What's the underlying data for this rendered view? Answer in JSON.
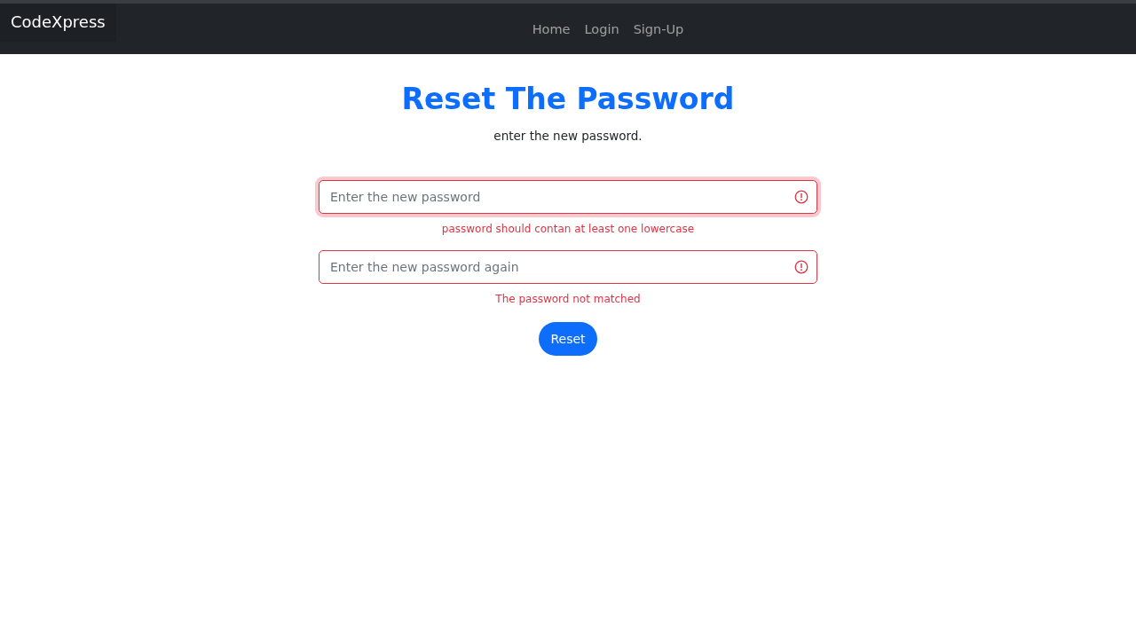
{
  "navbar": {
    "brand": "CodeXpress",
    "links": [
      {
        "label": "Home"
      },
      {
        "label": "Login"
      },
      {
        "label": "Sign-Up"
      }
    ]
  },
  "heading": "Reset The Password",
  "subtitle": "enter the new password.",
  "fields": [
    {
      "placeholder": "Enter the new password",
      "invalid": true,
      "focused": true,
      "error": "password should contan at least one lowercase"
    },
    {
      "placeholder": "Enter the new password again",
      "invalid": true,
      "focused": false,
      "error": "The password not matched"
    }
  ],
  "button": "Reset"
}
